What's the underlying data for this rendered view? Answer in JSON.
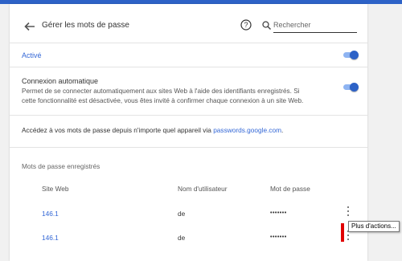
{
  "header": {
    "title": "Gérer les mots de passe",
    "search_placeholder": "Rechercher"
  },
  "offer_to_save": {
    "label": "Activé",
    "enabled": true
  },
  "auto_signin": {
    "title": "Connexion automatique",
    "description": "Permet de se connecter automatiquement aux sites Web à l'aide des identifiants enregistrés. Si cette fonctionnalité est désactivée, vous êtes invité à confirmer chaque connexion à un site Web.",
    "enabled": true
  },
  "access": {
    "text": "Accédez à vos mots de passe depuis n'importe quel appareil via ",
    "link": "passwords.google.com",
    "suffix": "."
  },
  "saved": {
    "heading": "Mots de passe enregistrés",
    "columns": [
      "Site Web",
      "Nom d'utilisateur",
      "Mot de passe"
    ],
    "rows": [
      {
        "site": "146.1",
        "username": "de",
        "password": "•••••••"
      },
      {
        "site": "146.1",
        "username": "de",
        "password": "•••••••"
      }
    ]
  },
  "tooltip": "Plus d'actions...",
  "colors": {
    "accent": "#3367d6",
    "toggle_on": "#2d62c7",
    "highlight": "#e00000"
  },
  "icons": [
    "back-arrow-icon",
    "help-icon",
    "search-icon",
    "more-vert-icon"
  ]
}
